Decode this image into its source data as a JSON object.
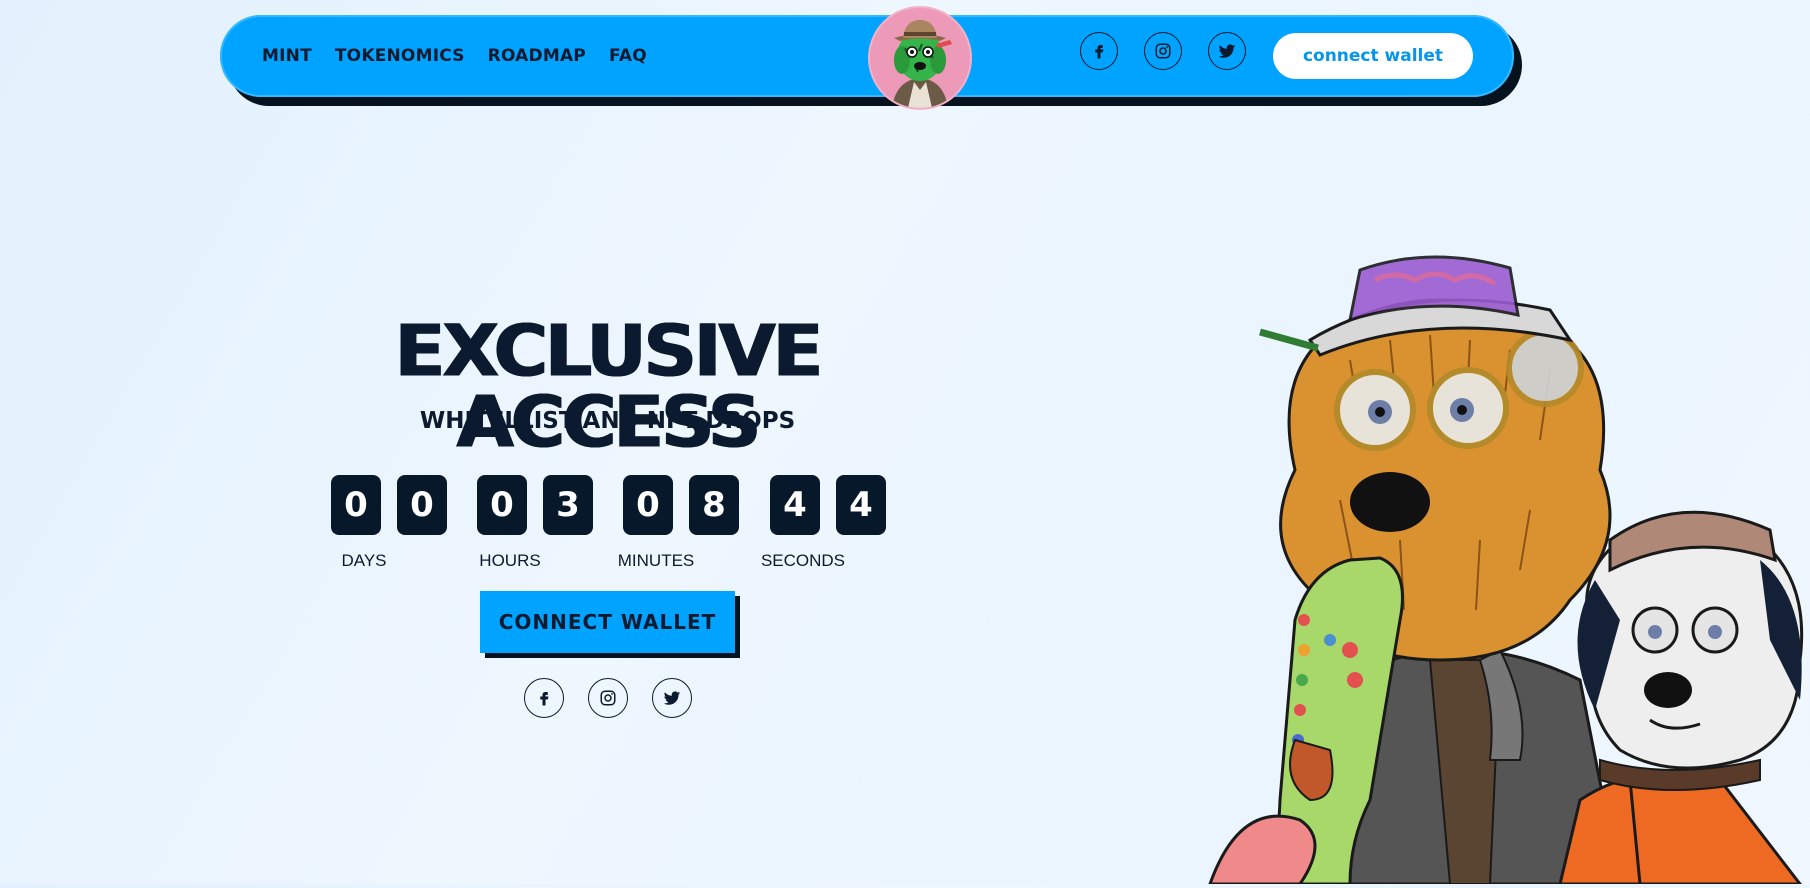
{
  "header": {
    "nav_links": [
      "MINT",
      "TOKENOMICS",
      "ROADMAP",
      "FAQ"
    ],
    "logo_icon": "dog-avatar-logo",
    "social_icons": [
      "facebook-icon",
      "instagram-icon",
      "twitter-icon"
    ],
    "cta_label": "connect wallet"
  },
  "hero": {
    "title": "EXCLUSIVE ACCESS",
    "subtitle": "WHITELLIST AND NFT DROPS",
    "countdown": {
      "units": [
        {
          "label": "DAYS",
          "digits": [
            "0",
            "0"
          ]
        },
        {
          "label": "HOURS",
          "digits": [
            "0",
            "3"
          ]
        },
        {
          "label": "MINUTES",
          "digits": [
            "0",
            "8"
          ]
        },
        {
          "label": "SECONDS",
          "digits": [
            "4",
            "4"
          ]
        }
      ]
    },
    "cta_label": "CONNECT WALLET",
    "social_icons": [
      "facebook-icon",
      "instagram-icon",
      "twitter-icon"
    ]
  },
  "colors": {
    "brand_blue": "#00a3ff",
    "navy": "#0b1a2e",
    "digit_bg": "#08182b",
    "background": "#e8f4fe"
  },
  "illustration": "dog-characters-illustration"
}
